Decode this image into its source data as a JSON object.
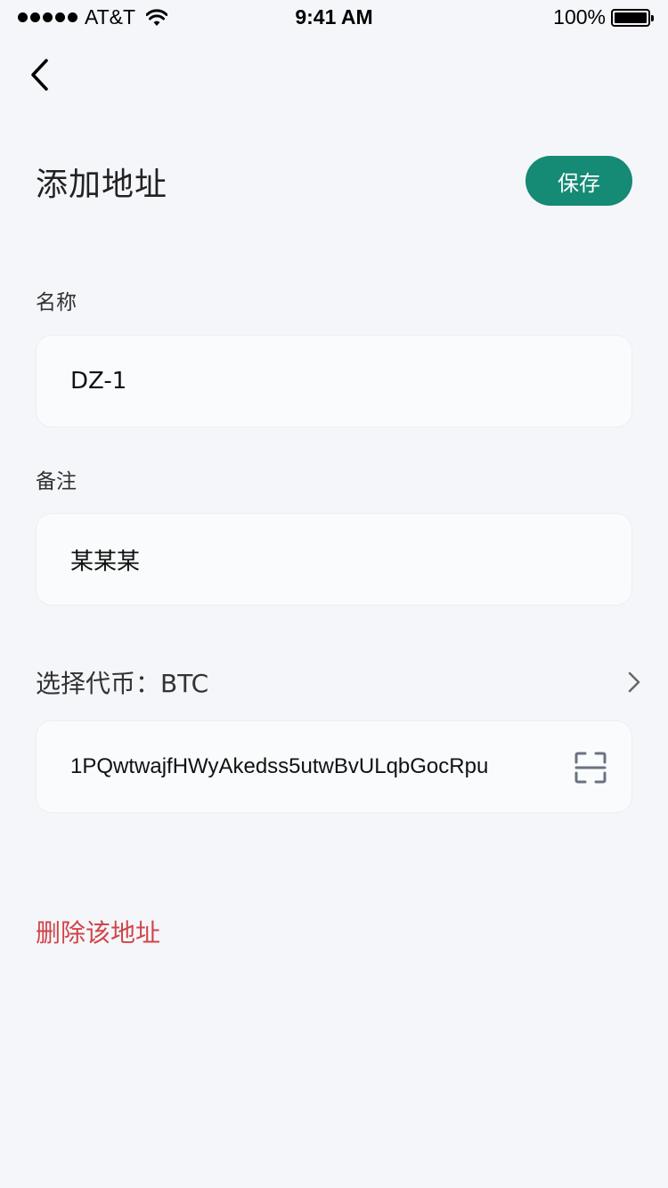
{
  "status_bar": {
    "carrier": "AT&T",
    "time": "9:41 AM",
    "battery": "100%"
  },
  "header": {
    "title": "添加地址",
    "save_label": "保存"
  },
  "form": {
    "name_label": "名称",
    "name_value": "DZ-1",
    "note_label": "备注",
    "note_value": "某某某",
    "coin_label": "选择代币：BTC",
    "address_value": "1PQwtwajfHWyAkedss5utwBvULqbGocRpu"
  },
  "actions": {
    "delete_label": "删除该地址"
  },
  "colors": {
    "accent": "#158a74",
    "danger": "#d0454a",
    "background": "#f5f6fa"
  },
  "icons": [
    "back-icon",
    "chevron-right-icon",
    "scan-icon",
    "wifi-icon",
    "battery-icon"
  ]
}
